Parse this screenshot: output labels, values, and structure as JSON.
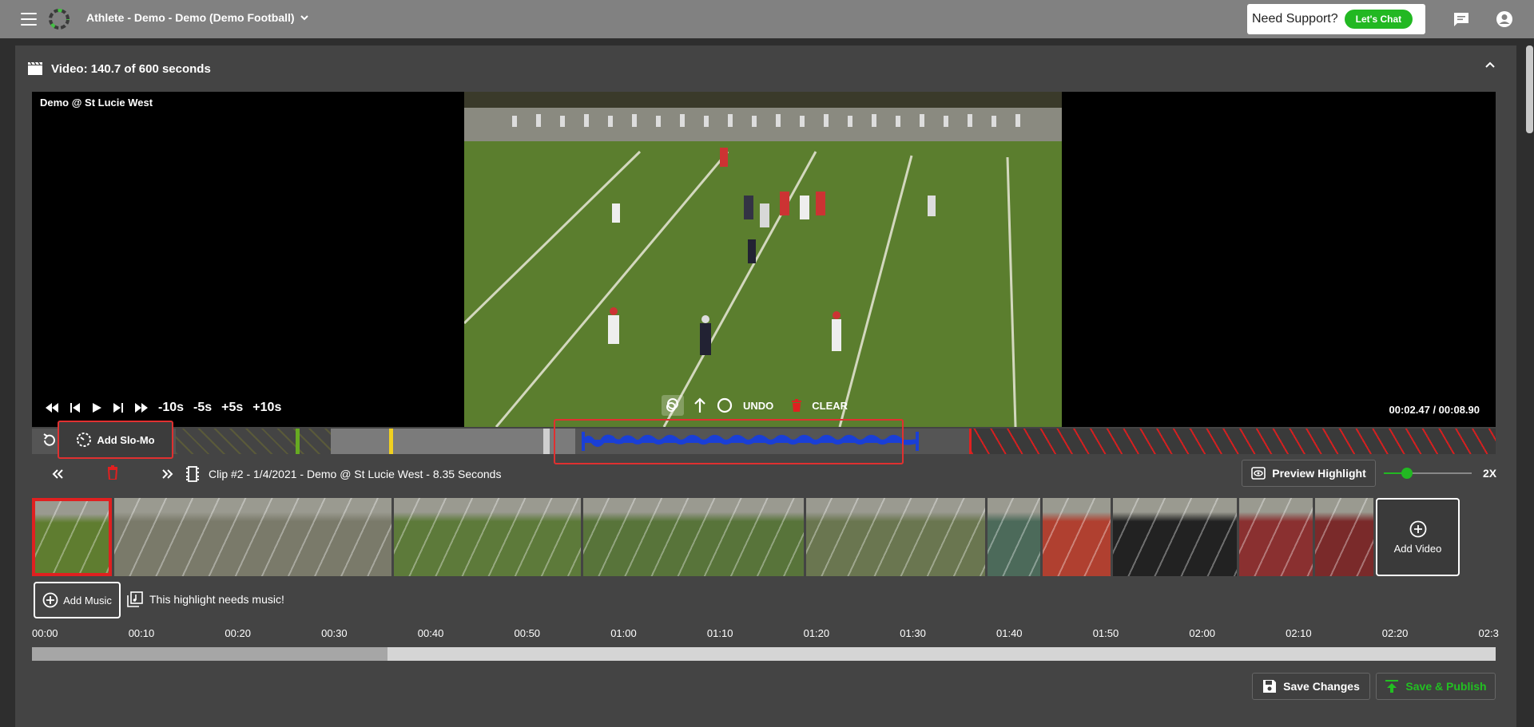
{
  "app": {
    "title": "Athlete - Demo - Demo (Demo Football)",
    "support_text": "Need Support?",
    "chat_label": "Let's Chat"
  },
  "panel": {
    "header": "Video: 140.7 of 600 seconds"
  },
  "player": {
    "game_title": "Demo @ St Lucie West",
    "skip_back_10": "-10s",
    "skip_back_5": "-5s",
    "skip_fwd_5": "+5s",
    "skip_fwd_10": "+10s",
    "undo_label": "UNDO",
    "clear_label": "CLEAR",
    "time": "00:02.47 / 00:08.90"
  },
  "clipbar": {
    "slomo_label": "Add Slo-Mo"
  },
  "clip": {
    "info": "Clip #2 - 1/4/2021 - Demo @ St Lucie West - 8.35 Seconds",
    "preview_label": "Preview Highlight",
    "speed_label": "2X",
    "speed_level": 0.2
  },
  "thumbnails": [
    {
      "name": "thumb-1",
      "color": "#5f7d30",
      "active": true
    },
    {
      "name": "thumb-2",
      "color": "#7a7a6a",
      "active": false
    },
    {
      "name": "thumb-3",
      "color": "#5d7a3a",
      "active": false
    },
    {
      "name": "thumb-4",
      "color": "#58743a",
      "active": false
    },
    {
      "name": "thumb-5",
      "color": "#6a7650",
      "active": false
    },
    {
      "name": "thumb-6",
      "color": "#4c6a5a",
      "active": false
    },
    {
      "name": "thumb-7",
      "color": "#b04030",
      "active": false
    },
    {
      "name": "thumb-8",
      "color": "#222222",
      "active": false
    },
    {
      "name": "thumb-9",
      "color": "#8a3030",
      "active": false
    },
    {
      "name": "thumb-10",
      "color": "#7a2a2a",
      "active": false
    }
  ],
  "add_video_label": "Add Video",
  "music": {
    "add_label": "Add Music",
    "notice": "This highlight needs music!"
  },
  "timeline": {
    "ticks": [
      "00:00",
      "00:10",
      "00:20",
      "00:30",
      "00:40",
      "00:50",
      "01:00",
      "01:10",
      "01:20",
      "01:30",
      "01:40",
      "01:50",
      "02:00",
      "02:10",
      "02:20",
      "02:3"
    ],
    "progress": 0.243
  },
  "actions": {
    "save_label": "Save Changes",
    "publish_label": "Save & Publish"
  },
  "colors": {
    "accent_green": "#22b822",
    "highlight_red": "#e03030",
    "slomo_blue": "#1a3fd6"
  }
}
